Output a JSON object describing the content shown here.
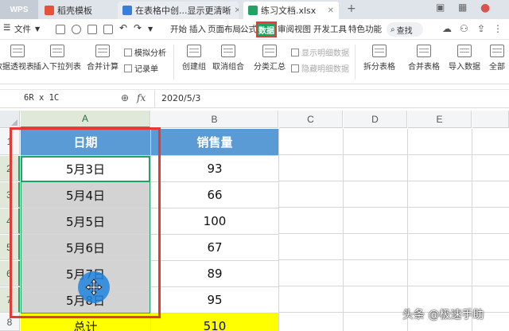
{
  "tabs": {
    "wps": "WPS",
    "tab1": "稻壳模板",
    "tab2": "在表格中创...显示更清晰",
    "tab3": "练习文档.xlsx",
    "add": "+"
  },
  "menu": {
    "file": "文件",
    "items": [
      "开始",
      "插入",
      "页面布局",
      "公式",
      "数据",
      "审阅",
      "视图",
      "开发工具",
      "特色功能"
    ],
    "active": "数据",
    "search": "查找"
  },
  "ribbon": {
    "buttons": [
      "数据透视表",
      "插入下拉列表",
      "合并计算",
      "记录单",
      "创建组",
      "取消组合",
      "分类汇总",
      "拆分表格",
      "合并表格",
      "导入数据",
      "全部"
    ],
    "small": {
      "simulate": "模拟分析",
      "record": "记录单",
      "show_detail": "显示明细数据",
      "hide_detail": "隐藏明细数据"
    }
  },
  "formula_bar": {
    "name_box": "6R x 1C",
    "value": "2020/5/3"
  },
  "columns": [
    "A",
    "B",
    "C",
    "D",
    "E"
  ],
  "rows": [
    "1",
    "2",
    "3",
    "4",
    "5",
    "6",
    "7",
    "8"
  ],
  "table": {
    "headers": [
      "日期",
      "销售量"
    ],
    "rows": [
      [
        "5月3日",
        "93"
      ],
      [
        "5月4日",
        "66"
      ],
      [
        "5月5日",
        "100"
      ],
      [
        "5月6日",
        "67"
      ],
      [
        "5月7日",
        "89"
      ],
      [
        "5月8日",
        "95"
      ]
    ],
    "total": [
      "总计",
      "510"
    ]
  },
  "watermark": "头条 @极速手助",
  "colors": {
    "header_blue": "#5b9bd5",
    "total_yellow": "#ffff00",
    "highlight_red": "#e53935",
    "accent_green": "#21a366",
    "cursor_blue": "#2182dc"
  }
}
